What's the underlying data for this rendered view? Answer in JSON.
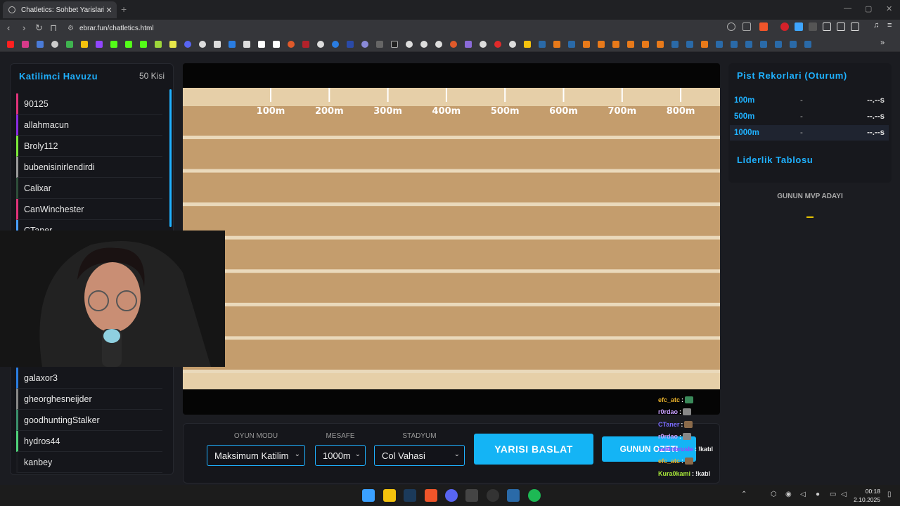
{
  "browser": {
    "tab_title": "Chatletics: Sohbet Yarislari",
    "url": "ebrar.fun/chatletics.html"
  },
  "pool": {
    "title": "Katilimci Havuzu",
    "count": "50 Kisi",
    "participants": [
      {
        "name": "90125",
        "color": "#e0337a"
      },
      {
        "name": "allahmacun",
        "color": "#8a2be2"
      },
      {
        "name": "Broly112",
        "color": "#7ce83a"
      },
      {
        "name": "bubenisinirlendirdi",
        "color": "#999999"
      },
      {
        "name": "Calixar",
        "color": "#2e4d3a"
      },
      {
        "name": "CanWinchester",
        "color": "#e0337a"
      },
      {
        "name": "CTaner",
        "color": "#4a9fff"
      },
      {
        "name": "galaxor3",
        "color": "#2a7de1"
      },
      {
        "name": "gheorghesneijder",
        "color": "#888888"
      },
      {
        "name": "goodhuntingStalker",
        "color": "#3b8f6b"
      },
      {
        "name": "hydros44",
        "color": "#4fd17a"
      },
      {
        "name": "kanbey",
        "color": "#1b1c21"
      }
    ]
  },
  "track": {
    "markers": [
      "100m",
      "200m",
      "300m",
      "400m",
      "500m",
      "600m",
      "700m",
      "800m"
    ],
    "lanes": 8
  },
  "controls": {
    "mode_label": "OYUN MODU",
    "mode_value": "Maksimum Katilim",
    "distance_label": "MESAFE",
    "distance_value": "1000m",
    "stadium_label": "STADYUM",
    "stadium_value": "Col Vahasi",
    "start_button": "YARISI BASLAT",
    "summary_button": "GUNUN OZETI"
  },
  "records": {
    "title": "Pist Rekorlari (Oturum)",
    "rows": [
      {
        "distance": "100m",
        "name": "-",
        "time": "--.--s"
      },
      {
        "distance": "500m",
        "name": "-",
        "time": "--.--s"
      },
      {
        "distance": "1000m",
        "name": "-",
        "time": "--.--s"
      }
    ]
  },
  "leaderboard": {
    "title": "Liderlik Tablosu",
    "mvp_label": "GUNUN MVP ADAYI"
  },
  "chat": [
    {
      "user": "efc_atc",
      "color": "#e8b02a",
      "message": ""
    },
    {
      "user": "r0rdao",
      "color": "#c9a0ff",
      "message": ""
    },
    {
      "user": "CTaner",
      "color": "#7a6bff",
      "message": ""
    },
    {
      "user": "r0rdao",
      "color": "#c9a0ff",
      "message": ""
    },
    {
      "user": "sel4nbrusle",
      "color": "#a040ff",
      "message": "!katıl"
    },
    {
      "user": "efc_atc",
      "color": "#e8b02a",
      "message": ""
    },
    {
      "user": "Kura0kami",
      "color": "#a8e83a",
      "message": "!katıl"
    }
  ],
  "system": {
    "time": "00:18",
    "date": "2.10.2025"
  }
}
